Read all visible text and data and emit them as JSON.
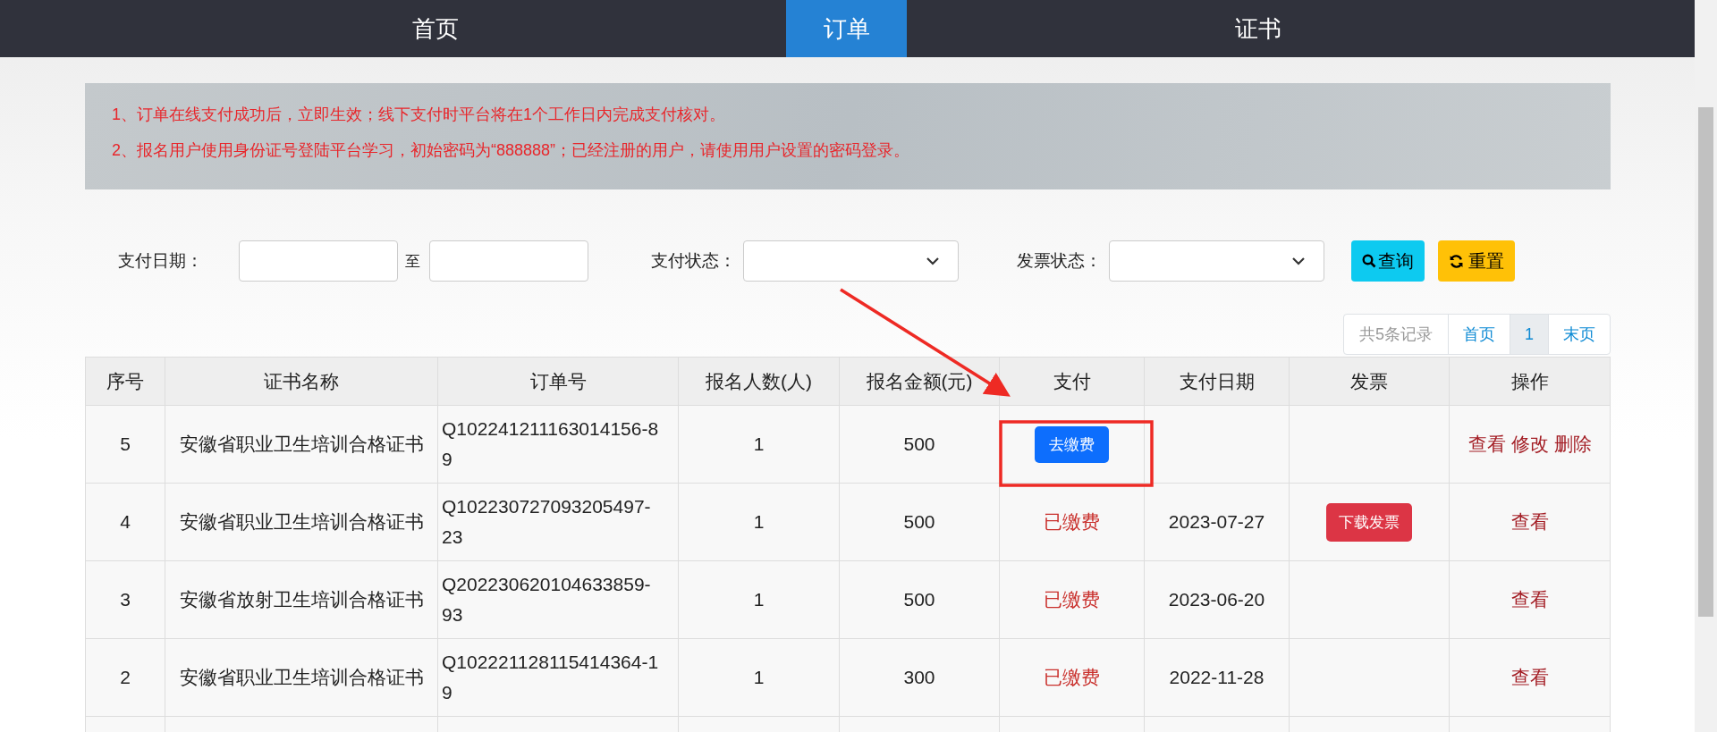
{
  "nav": {
    "items": [
      {
        "label": "首页",
        "selected": false
      },
      {
        "label": "订单",
        "selected": true
      },
      {
        "label": "证书",
        "selected": false
      }
    ]
  },
  "notice": {
    "lines": [
      "1、订单在线支付成功后，立即生效；线下支付时平台将在1个工作日内完成支付核对。",
      "2、报名用户使用身份证号登陆平台学习，初始密码为“888888”；已经注册的用户，请使用用户设置的密码登录。"
    ]
  },
  "filters": {
    "pay_date_label": "支付日期：",
    "range_separator": "至",
    "pay_status_label": "支付状态：",
    "invoice_status_label": "发票状态：",
    "buttons": [
      {
        "kind": "search",
        "label": "查询"
      },
      {
        "kind": "reset",
        "label": "重置"
      }
    ]
  },
  "pagination": {
    "total": "共5条记录",
    "first": "首页",
    "pages": [
      {
        "label": "1",
        "selected": true
      }
    ],
    "last": "末页"
  },
  "table": {
    "columns": [
      "序号",
      "证书名称",
      "订单号",
      "报名人数(人)",
      "报名金额(元)",
      "支付",
      "支付日期",
      "发票",
      "操作"
    ],
    "rows": [
      {
        "index": "5",
        "name": "安徽省职业卫生培训合格证书",
        "order_no": "Q102241211163014156-89",
        "count": "1",
        "amount": "500",
        "pay": {
          "kind": "button",
          "label": "去缴费"
        },
        "actions": [
          "查看",
          "修改",
          "删除"
        ]
      },
      {
        "index": "4",
        "name": "安徽省职业卫生培训合格证书",
        "order_no": "Q102230727093205497-23",
        "count": "1",
        "amount": "500",
        "pay": {
          "kind": "text",
          "label": "已缴费"
        },
        "pay_date": "2023-07-27",
        "invoice": "下载发票",
        "actions": [
          "查看"
        ]
      },
      {
        "index": "3",
        "name": "安徽省放射卫生培训合格证书",
        "order_no": "Q202230620104633859-93",
        "count": "1",
        "amount": "500",
        "pay": {
          "kind": "text",
          "label": "已缴费"
        },
        "pay_date": "2023-06-20",
        "actions": [
          "查看"
        ]
      },
      {
        "index": "2",
        "name": "安徽省职业卫生培训合格证书",
        "order_no": "Q102221128115414364-19",
        "count": "1",
        "amount": "300",
        "pay": {
          "kind": "text",
          "label": "已缴费"
        },
        "pay_date": "2022-11-28",
        "actions": [
          "查看"
        ]
      }
    ]
  }
}
